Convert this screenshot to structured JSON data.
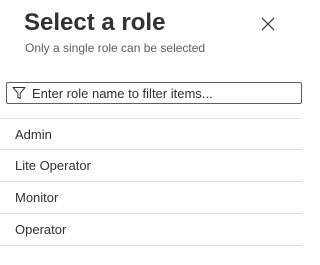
{
  "dialog": {
    "title": "Select a role",
    "subtitle": "Only a single role can be selected",
    "close_icon": "close-icon"
  },
  "filter": {
    "icon": "filter-icon",
    "placeholder": "Enter role name to filter items...",
    "value": ""
  },
  "roles": [
    {
      "label": "Admin"
    },
    {
      "label": "Lite Operator"
    },
    {
      "label": "Monitor"
    },
    {
      "label": "Operator"
    }
  ],
  "colors": {
    "text": "#323130",
    "subtext": "#605e5c",
    "divider": "#e1dfdd",
    "border": "#605e5c"
  }
}
